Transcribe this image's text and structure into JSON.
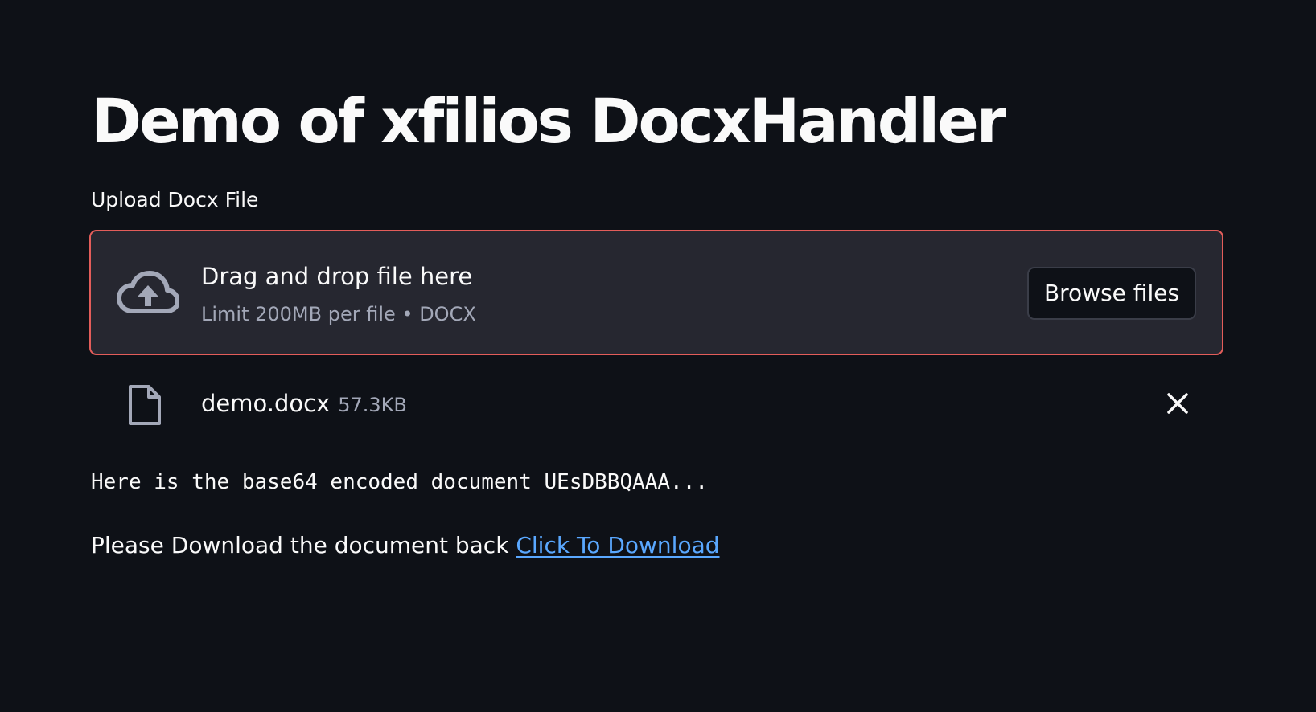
{
  "page": {
    "title": "Demo of xfilios DocxHandler"
  },
  "uploader": {
    "label": "Upload Docx File",
    "drop_title": "Drag and drop file here",
    "drop_limit": "Limit 200MB per file • DOCX",
    "browse_label": "Browse files",
    "cloud_icon": "cloud-upload-icon",
    "border_color": "#e35d5a"
  },
  "uploaded_file": {
    "name": "demo.docx",
    "size": "57.3KB",
    "file_icon": "document-icon",
    "remove_icon": "close-icon"
  },
  "output": {
    "encoded_text": "Here is the base64 encoded document UEsDBBQAAA...",
    "download_prefix": "Please Download the document back",
    "download_link_label": "Click To Download",
    "link_color": "#5aa8ff"
  },
  "theme": {
    "background": "#0e1117",
    "surface": "#262730",
    "text": "#fafafa",
    "muted_text": "#a3a8b8"
  }
}
